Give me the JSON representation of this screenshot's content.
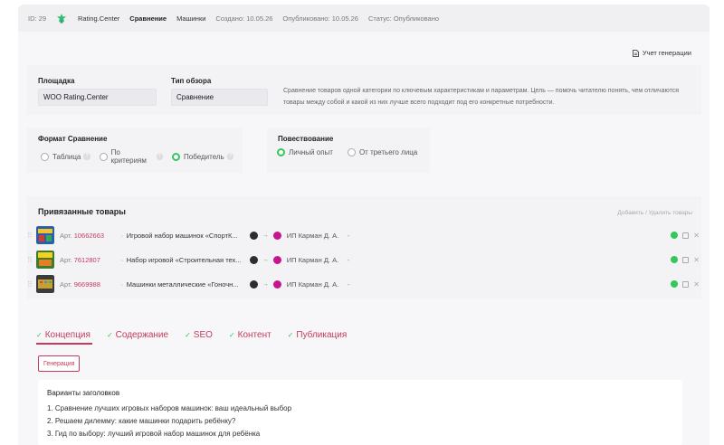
{
  "topbar": {
    "id": "ID: 29",
    "site": "Rating.Center",
    "type": "Сравнение",
    "topic": "Машинки",
    "created": "Создано: 10.05.26",
    "published": "Опубликовано: 10.05.26",
    "status": "Статус: Опубликовано"
  },
  "generation_log": "Учет генерации",
  "platform": {
    "label": "Площадка",
    "value": "WOO Rating.Center"
  },
  "review_type": {
    "label": "Тип обзора",
    "value": "Сравнение",
    "description": "Сравнение товаров одной категории по ключевым характеристикам и параметрам. Цель — помочь читателю понять, чем отличаются товары между собой и какой из них лучше всего подходит под его конкретные потребности."
  },
  "format": {
    "label": "Формат Сравнение",
    "options": [
      "Таблица",
      "По критериям",
      "Победитель"
    ],
    "selected": "Победитель"
  },
  "narration": {
    "label": "Повествование",
    "options": [
      "Личный опыт",
      "От третьего лица"
    ],
    "selected": "Личный опыт"
  },
  "products": {
    "title": "Привязанные товары",
    "add_remove": "Добавить / Удалить товары",
    "art_label": "Арт.",
    "items": [
      {
        "article": "10662663",
        "name": "Игровой набор машинок «СпортК...",
        "seller": "ИП Карман Д. А.",
        "dash": "-",
        "sep": "·"
      },
      {
        "article": "7612807",
        "name": "Набор игровой «Строительная тех...",
        "seller": "ИП Карман Д. А.",
        "dash": "-",
        "sep": "·"
      },
      {
        "article": "9669988",
        "name": "Машинки металлические «Гоночн...",
        "seller": "ИП Карман Д. А.",
        "dash": "-",
        "sep": "·"
      }
    ]
  },
  "tabs": [
    {
      "label": "Концепция",
      "active": true
    },
    {
      "label": "Содержание"
    },
    {
      "label": "SEO"
    },
    {
      "label": "Контент"
    },
    {
      "label": "Публикация"
    }
  ],
  "generate_button": "Генерация",
  "headline_variants": {
    "title": "Варианты заголовков",
    "items": [
      "1. Сравнение лучших игровых наборов машинок: ваш идеальный выбор",
      "2. Решаем дилемму: какие машинки подарить ребёнку?",
      "3. Гид по выбору: лучший игровой набор машинок для ребёнка"
    ]
  },
  "colors": {
    "accent": "#c53b5e",
    "success": "#34c759"
  }
}
